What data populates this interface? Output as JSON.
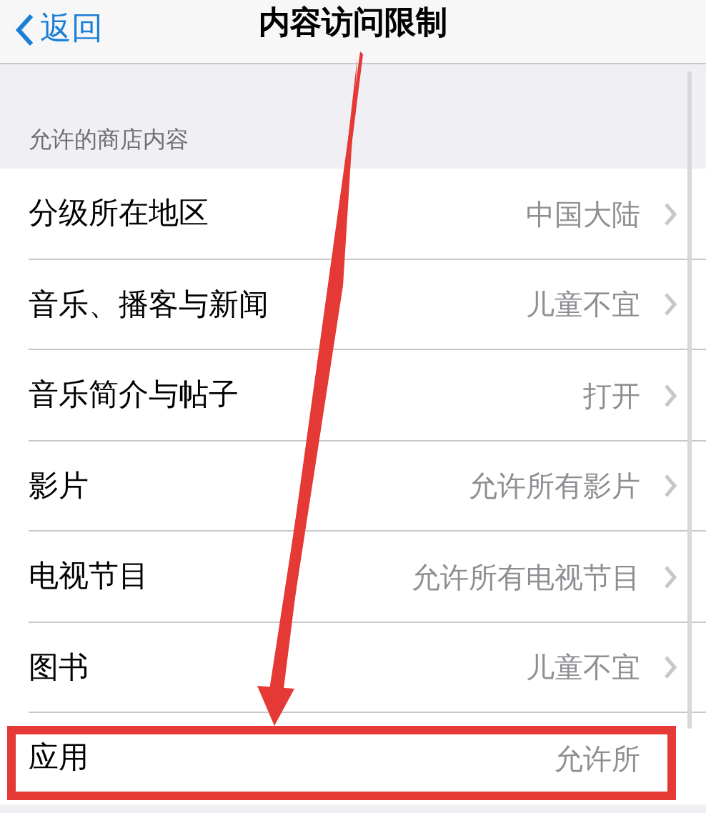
{
  "nav": {
    "back": "返回",
    "title": "内容访问限制"
  },
  "section_header": "允许的商店内容",
  "rows": [
    {
      "label": "分级所在地区",
      "value": "中国大陆",
      "chevron": true
    },
    {
      "label": "音乐、播客与新闻",
      "value": "儿童不宜",
      "chevron": true
    },
    {
      "label": "音乐简介与帖子",
      "value": "打开",
      "chevron": true
    },
    {
      "label": "影片",
      "value": "允许所有影片",
      "chevron": true
    },
    {
      "label": "电视节目",
      "value": "允许所有电视节目",
      "chevron": true
    },
    {
      "label": "图书",
      "value": "儿童不宜",
      "chevron": true
    },
    {
      "label": "应用",
      "value": "允许所",
      "chevron": false
    }
  ]
}
